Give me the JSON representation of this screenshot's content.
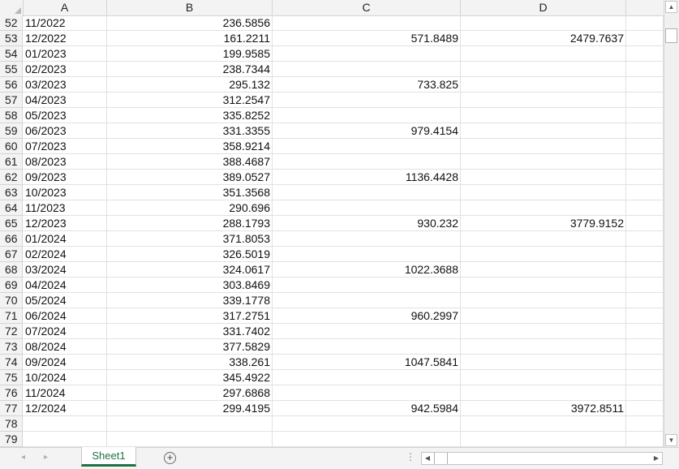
{
  "columns": [
    "A",
    "B",
    "C",
    "D"
  ],
  "rows": [
    {
      "n": "52",
      "a": "11/2022",
      "b": "236.5856",
      "c": "",
      "d": ""
    },
    {
      "n": "53",
      "a": "12/2022",
      "b": "161.2211",
      "c": "571.8489",
      "d": "2479.7637"
    },
    {
      "n": "54",
      "a": "01/2023",
      "b": "199.9585",
      "c": "",
      "d": ""
    },
    {
      "n": "55",
      "a": "02/2023",
      "b": "238.7344",
      "c": "",
      "d": ""
    },
    {
      "n": "56",
      "a": "03/2023",
      "b": "295.132",
      "c": "733.825",
      "d": ""
    },
    {
      "n": "57",
      "a": "04/2023",
      "b": "312.2547",
      "c": "",
      "d": ""
    },
    {
      "n": "58",
      "a": "05/2023",
      "b": "335.8252",
      "c": "",
      "d": ""
    },
    {
      "n": "59",
      "a": "06/2023",
      "b": "331.3355",
      "c": "979.4154",
      "d": ""
    },
    {
      "n": "60",
      "a": "07/2023",
      "b": "358.9214",
      "c": "",
      "d": ""
    },
    {
      "n": "61",
      "a": "08/2023",
      "b": "388.4687",
      "c": "",
      "d": ""
    },
    {
      "n": "62",
      "a": "09/2023",
      "b": "389.0527",
      "c": "1136.4428",
      "d": ""
    },
    {
      "n": "63",
      "a": "10/2023",
      "b": "351.3568",
      "c": "",
      "d": ""
    },
    {
      "n": "64",
      "a": "11/2023",
      "b": "290.696",
      "c": "",
      "d": ""
    },
    {
      "n": "65",
      "a": "12/2023",
      "b": "288.1793",
      "c": "930.232",
      "d": "3779.9152"
    },
    {
      "n": "66",
      "a": "01/2024",
      "b": "371.8053",
      "c": "",
      "d": ""
    },
    {
      "n": "67",
      "a": "02/2024",
      "b": "326.5019",
      "c": "",
      "d": ""
    },
    {
      "n": "68",
      "a": "03/2024",
      "b": "324.0617",
      "c": "1022.3688",
      "d": ""
    },
    {
      "n": "69",
      "a": "04/2024",
      "b": "303.8469",
      "c": "",
      "d": ""
    },
    {
      "n": "70",
      "a": "05/2024",
      "b": "339.1778",
      "c": "",
      "d": ""
    },
    {
      "n": "71",
      "a": "06/2024",
      "b": "317.2751",
      "c": "960.2997",
      "d": ""
    },
    {
      "n": "72",
      "a": "07/2024",
      "b": "331.7402",
      "c": "",
      "d": ""
    },
    {
      "n": "73",
      "a": "08/2024",
      "b": "377.5829",
      "c": "",
      "d": ""
    },
    {
      "n": "74",
      "a": "09/2024",
      "b": "338.261",
      "c": "1047.5841",
      "d": ""
    },
    {
      "n": "75",
      "a": "10/2024",
      "b": "345.4922",
      "c": "",
      "d": ""
    },
    {
      "n": "76",
      "a": "11/2024",
      "b": "297.6868",
      "c": "",
      "d": ""
    },
    {
      "n": "77",
      "a": "12/2024",
      "b": "299.4195",
      "c": "942.5984",
      "d": "3972.8511"
    },
    {
      "n": "78",
      "a": "",
      "b": "",
      "c": "",
      "d": ""
    },
    {
      "n": "79",
      "a": "",
      "b": "",
      "c": "",
      "d": ""
    }
  ],
  "sheet_tab": "Sheet1",
  "icons": {
    "add_sheet": "plus-circle-icon",
    "scroll_up": "triangle-up-icon",
    "scroll_down": "triangle-down-icon",
    "scroll_left": "triangle-left-icon",
    "scroll_right": "triangle-right-icon",
    "tab_prev": "chevron-left-icon",
    "tab_next": "chevron-right-icon"
  },
  "colors": {
    "accent": "#1e7145",
    "header_bg": "#f3f3f3",
    "gridline": "#e1e1e1"
  }
}
